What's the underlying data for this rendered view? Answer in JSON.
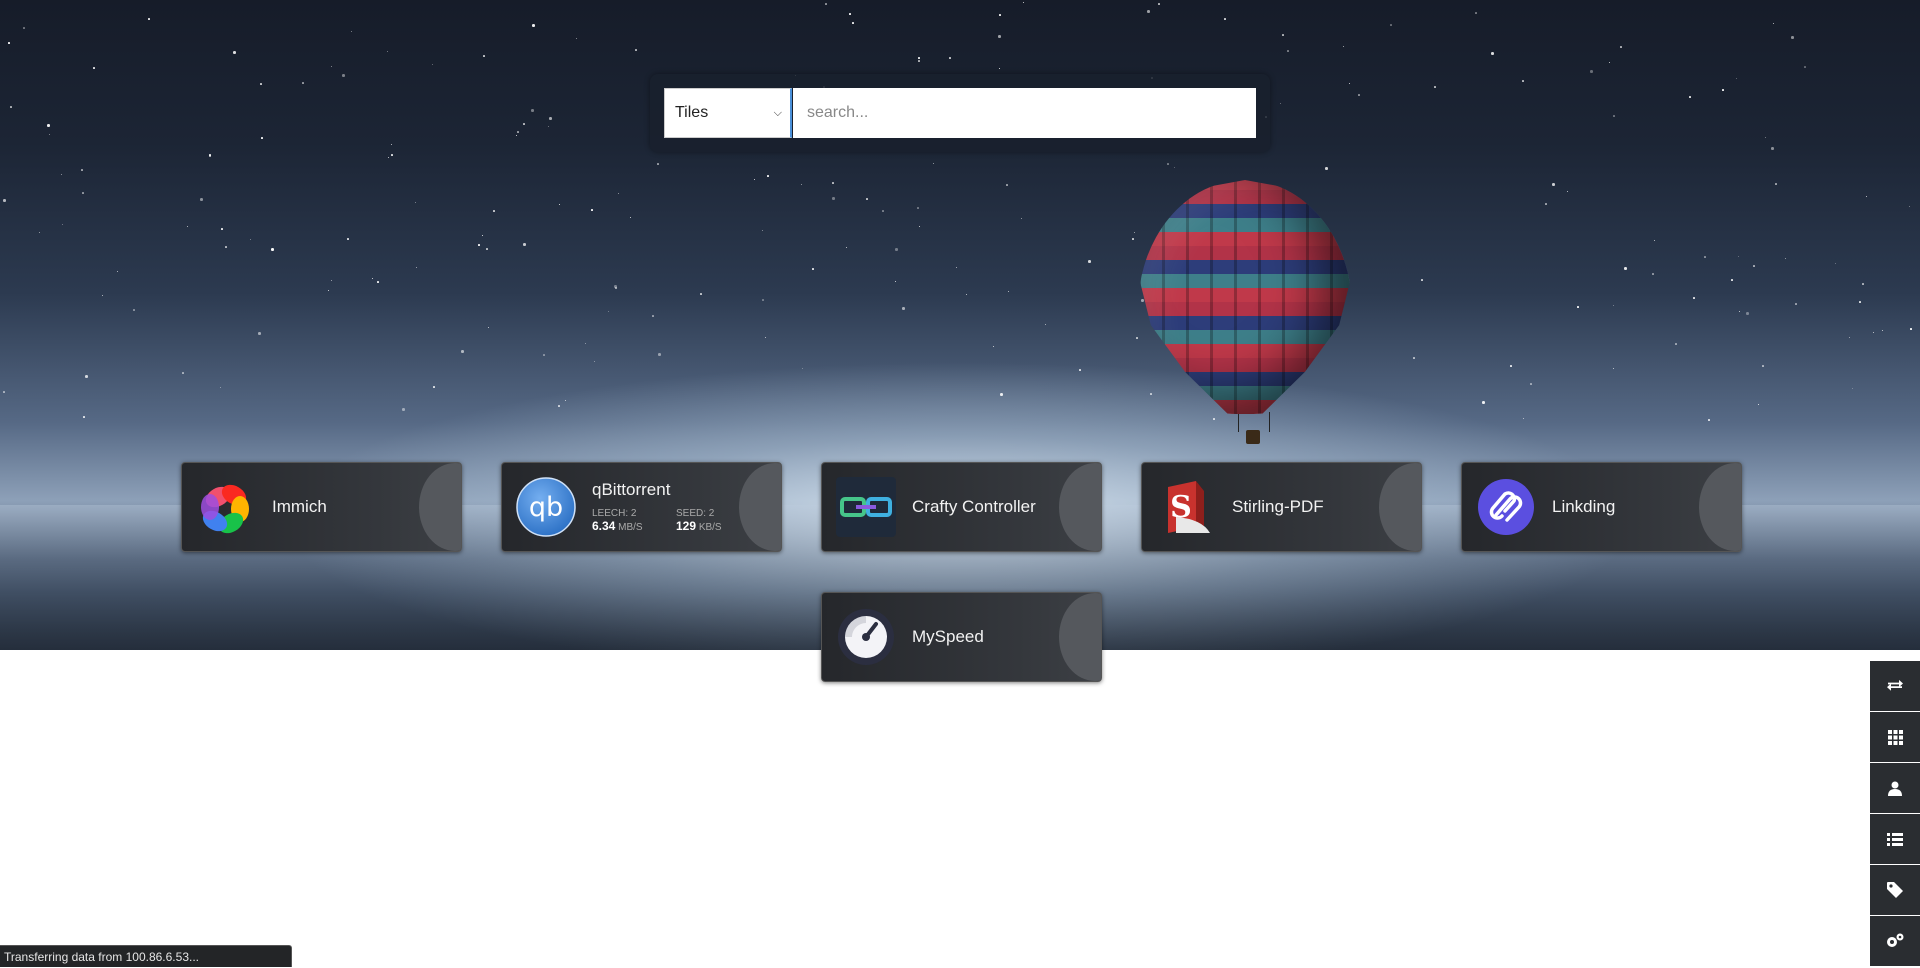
{
  "search": {
    "mode_selected": "Tiles",
    "placeholder": "search..."
  },
  "tiles": [
    {
      "name": "Immich",
      "icon": "immich-icon"
    },
    {
      "name": "qBittorrent",
      "icon": "qbittorrent-icon",
      "leech_label": "LEECH: 2",
      "leech_value": "6.34",
      "leech_unit": "MB/S",
      "seed_label": "SEED: 2",
      "seed_value": "129",
      "seed_unit": "KB/S"
    },
    {
      "name": "Crafty Controller",
      "icon": "crafty-icon"
    },
    {
      "name": "Stirling-PDF",
      "icon": "stirling-pdf-icon"
    },
    {
      "name": "Linkding",
      "icon": "linkding-icon"
    },
    {
      "name": "MySpeed",
      "icon": "myspeed-icon"
    }
  ],
  "sidebar": {
    "buttons": [
      "switch-icon",
      "grid-icon",
      "user-icon",
      "list-icon",
      "tag-icon",
      "settings-icon"
    ]
  },
  "status_bar": {
    "text": "Transferring data from 100.86.6.53..."
  },
  "colors": {
    "tile_bg": "#2f3135",
    "accent_blue": "#4a90d9",
    "linkding": "#5b4fe0"
  }
}
